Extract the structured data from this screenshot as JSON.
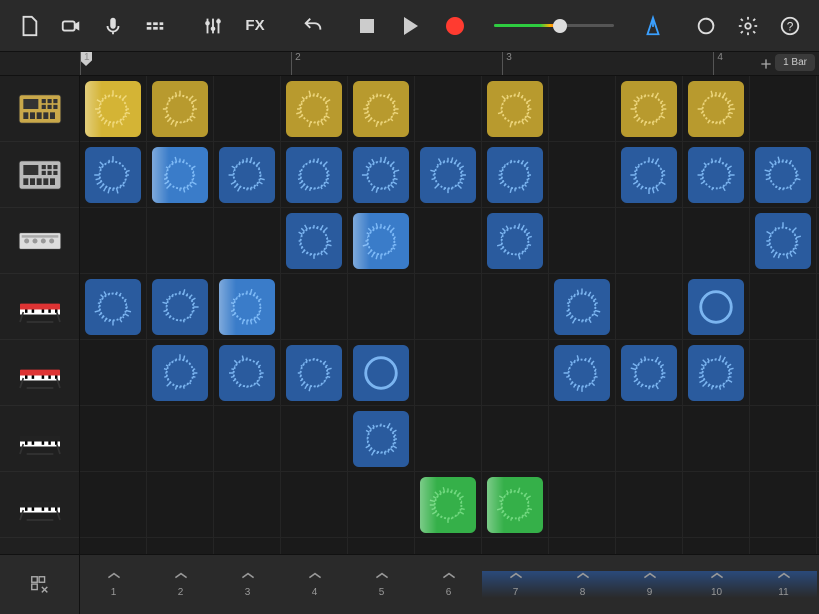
{
  "toolbar": {
    "icons": [
      "document",
      "camera",
      "microphone",
      "mixer",
      "sliders",
      "fx",
      "undo"
    ],
    "right_icons": [
      "metronome",
      "loop",
      "settings",
      "help"
    ]
  },
  "ruler": {
    "marks": [
      1,
      2,
      3,
      4
    ],
    "playhead_pos": 1,
    "bar_indicator": "1 Bar"
  },
  "volume": {
    "value": 55
  },
  "tracks": [
    {
      "id": "track-drums-1",
      "kind": "sampler",
      "color": "gold"
    },
    {
      "id": "track-drums-2",
      "kind": "sampler",
      "color": "silver"
    },
    {
      "id": "track-drumkit",
      "kind": "drumkit",
      "color": "white"
    },
    {
      "id": "track-keys-1",
      "kind": "keyboard",
      "color": "red"
    },
    {
      "id": "track-keys-2",
      "kind": "keyboard",
      "color": "red"
    },
    {
      "id": "track-keys-3",
      "kind": "keyboard",
      "color": "black"
    },
    {
      "id": "track-keys-4",
      "kind": "keyboard",
      "color": "black"
    }
  ],
  "grid": {
    "cols": 11,
    "rows": [
      {
        "color": "yellow",
        "cells": [
          {
            "c": 0,
            "playing": true
          },
          {
            "c": 1
          },
          {
            "c": 3
          },
          {
            "c": 4
          },
          {
            "c": 6
          },
          {
            "c": 8
          },
          {
            "c": 9
          }
        ]
      },
      {
        "color": "blue",
        "cells": [
          {
            "c": 0
          },
          {
            "c": 1,
            "playing": true
          },
          {
            "c": 2
          },
          {
            "c": 3
          },
          {
            "c": 4
          },
          {
            "c": 5
          },
          {
            "c": 6
          },
          {
            "c": 8
          },
          {
            "c": 9
          },
          {
            "c": 10
          }
        ]
      },
      {
        "color": "blue",
        "cells": [
          {
            "c": 3
          },
          {
            "c": 4,
            "playing": true
          },
          {
            "c": 6
          },
          {
            "c": 10
          }
        ]
      },
      {
        "color": "blue",
        "cells": [
          {
            "c": 0
          },
          {
            "c": 1
          },
          {
            "c": 2,
            "playing": true
          },
          {
            "c": 7
          },
          {
            "c": 9,
            "variant": "ring"
          }
        ]
      },
      {
        "color": "blue",
        "cells": [
          {
            "c": 1
          },
          {
            "c": 2
          },
          {
            "c": 3
          },
          {
            "c": 4,
            "variant": "ring"
          },
          {
            "c": 7
          },
          {
            "c": 8
          },
          {
            "c": 9
          }
        ]
      },
      {
        "color": "blue",
        "cells": [
          {
            "c": 4
          }
        ]
      },
      {
        "color": "green",
        "cells": [
          {
            "c": 5,
            "playing": true
          },
          {
            "c": 6,
            "playing": true
          }
        ]
      },
      {
        "color": "blue",
        "cells": [
          {
            "c": 6,
            "sel": true,
            "partial": true
          },
          {
            "c": 7,
            "sel": true,
            "partial": true
          }
        ]
      }
    ]
  },
  "footer": {
    "columns": [
      1,
      2,
      3,
      4,
      5,
      6,
      7,
      8,
      9,
      10,
      11
    ],
    "active": [
      7,
      8,
      9,
      10,
      11
    ]
  }
}
